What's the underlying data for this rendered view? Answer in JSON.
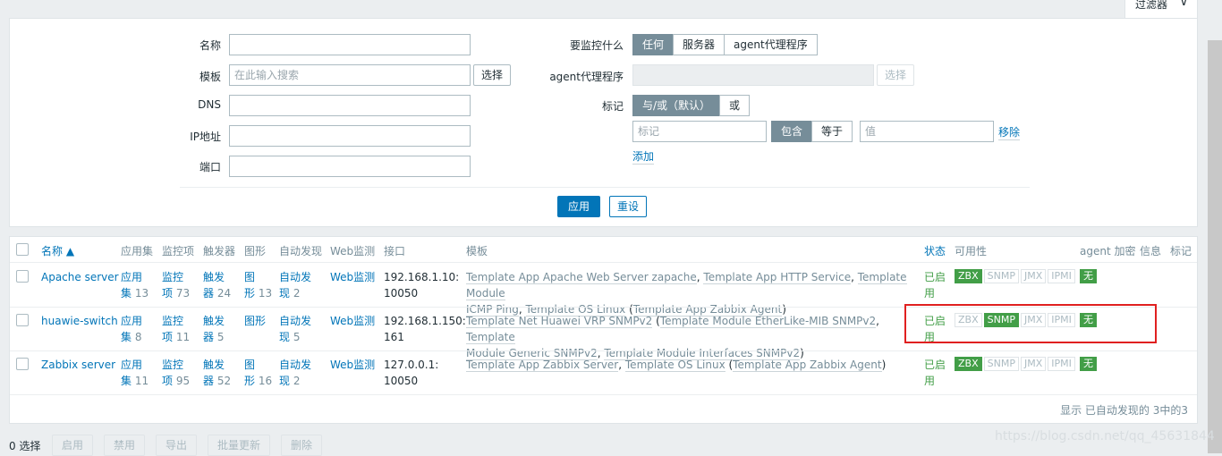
{
  "filter_tab": {
    "label": "过滤器"
  },
  "filter": {
    "name_label": "名称",
    "name_value": "",
    "template_label": "模板",
    "template_placeholder": "在此输入搜索",
    "select_label": "选择",
    "dns_label": "DNS",
    "ip_label": "IP地址",
    "port_label": "端口",
    "monitored_by_label": "要监控什么",
    "monitored_by_options": [
      "任何",
      "服务器",
      "agent代理程序"
    ],
    "proxy_label": "agent代理程序",
    "proxy_select_label": "选择",
    "tags_label": "标记",
    "tag_mode_options": [
      "与/或（默认）",
      "或"
    ],
    "tag_placeholder": "标记",
    "tag_operator_options": [
      "包含",
      "等于"
    ],
    "value_placeholder": "值",
    "remove_label": "移除",
    "add_label": "添加",
    "apply_label": "应用",
    "reset_label": "重设"
  },
  "table": {
    "headers": {
      "name": "名称 ▲",
      "applications": "应用集",
      "items": "监控项",
      "triggers": "触发器",
      "graphs": "图形",
      "discovery": "自动发现",
      "web": "Web监测",
      "interface": "接口",
      "templates": "模板",
      "status": "状态",
      "availability": "可用性",
      "encryption": "agent 加密",
      "info": "信息",
      "tags": "标记"
    },
    "rows": [
      {
        "name": "Apache server",
        "app_l1": "应用",
        "app_l2": "集",
        "app_count": "13",
        "items_l1": "监控",
        "items_l2": "项",
        "items_count": "73",
        "triggers_l1": "触发",
        "triggers_l2": "器",
        "triggers_count": "24",
        "graphs_l1": "图",
        "graphs_l2": "形",
        "graphs_count": "13",
        "disc_l1": "自动发",
        "disc_l2": "现",
        "disc_count": "2",
        "web": "Web监测",
        "iface_l1": "192.168.1.10:",
        "iface_l2": "10050",
        "tpl": [
          "Template App Apache Web Server zapache",
          "Template App HTTP Service",
          "Template Module",
          "ICMP Ping",
          "Template OS Linux",
          "Template App Zabbix Agent"
        ],
        "status_l1": "已启",
        "status_l2": "用",
        "avail_on": "ZBX",
        "encryption": "无"
      },
      {
        "name": "huawie-switch",
        "app_l1": "应用",
        "app_l2": "集",
        "app_count": "8",
        "items_l1": "监控",
        "items_l2": "项",
        "items_count": "11",
        "triggers_l1": "触发",
        "triggers_l2": "器",
        "triggers_count": "5",
        "graphs_single": "图形",
        "disc_l1": "自动发",
        "disc_l2": "现",
        "disc_count": "5",
        "web": "Web监测",
        "iface_l1": "192.168.1.150:",
        "iface_l2": "161",
        "tpl": [
          "Template Net Huawei VRP SNMPv2",
          "Template Module EtherLike-MIB SNMPv2",
          "Template",
          "Module Generic SNMPv2",
          "Template Module Interfaces SNMPv2"
        ],
        "status_l1": "已启",
        "status_l2": "用",
        "avail_on": "SNMP",
        "encryption": "无"
      },
      {
        "name": "Zabbix server",
        "app_l1": "应用",
        "app_l2": "集",
        "app_count": "11",
        "items_l1": "监控",
        "items_l2": "项",
        "items_count": "95",
        "triggers_l1": "触发",
        "triggers_l2": "器",
        "triggers_count": "52",
        "graphs_l1": "图",
        "graphs_l2": "形",
        "graphs_count": "16",
        "disc_l1": "自动发",
        "disc_l2": "现",
        "disc_count": "2",
        "web": "Web监测",
        "iface_l1": "127.0.0.1:",
        "iface_l2": "10050",
        "tpl": [
          "Template App Zabbix Server",
          "Template OS Linux",
          "Template App Zabbix Agent"
        ],
        "status_l1": "已启",
        "status_l2": "用",
        "avail_on": "ZBX",
        "encryption": "无"
      }
    ],
    "avail_labels": [
      "ZBX",
      "SNMP",
      "JMX",
      "IPMI"
    ],
    "footer": "显示 已自动发现的 3中的3"
  },
  "actions": {
    "selected": "0 选择",
    "enable": "启用",
    "disable": "禁用",
    "export": "导出",
    "mass_update": "批量更新",
    "delete": "删除"
  },
  "watermark": "https://blog.csdn.net/qq_45631844"
}
